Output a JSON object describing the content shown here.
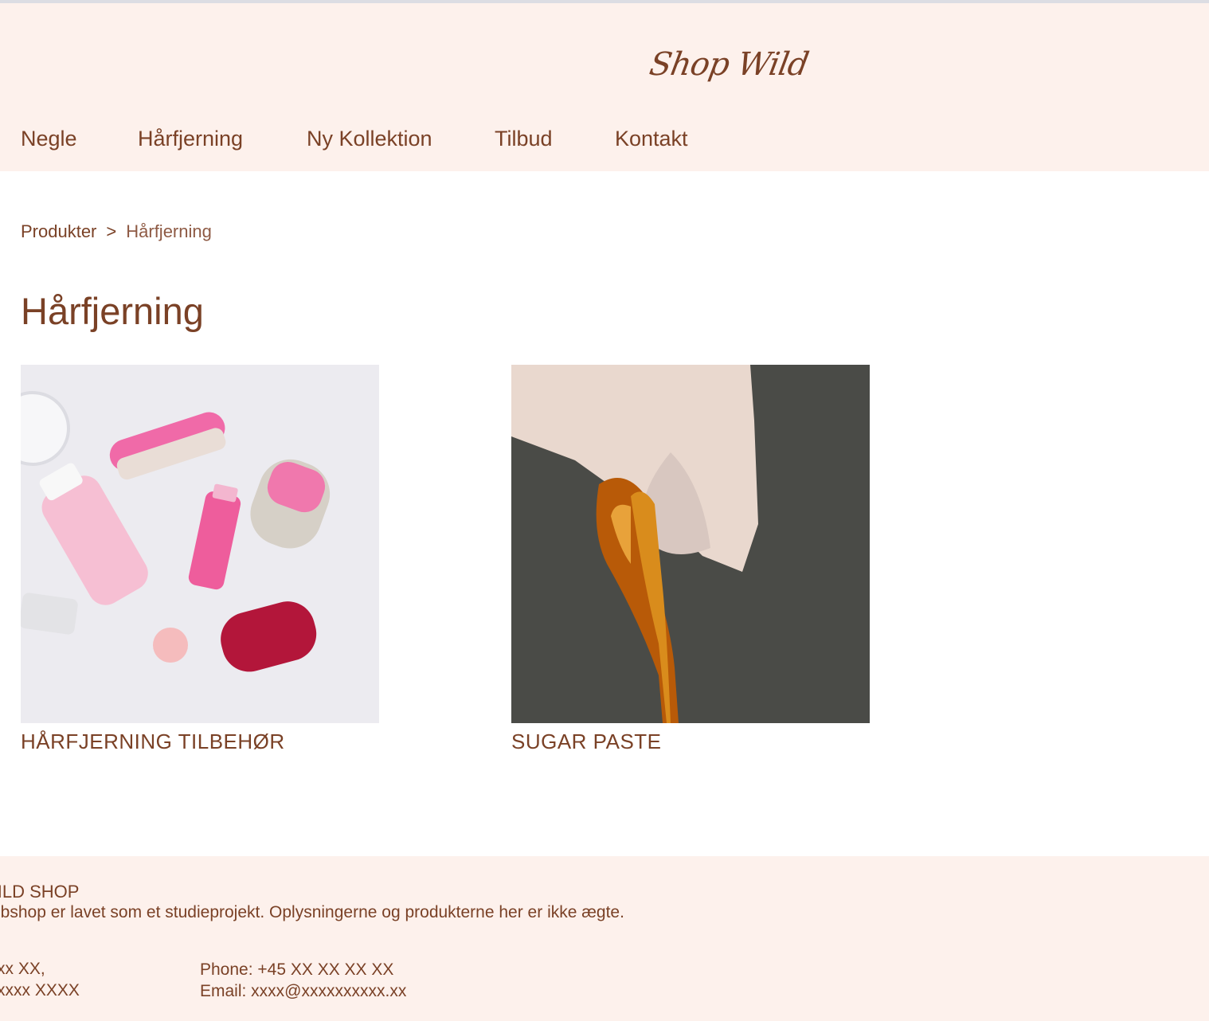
{
  "header": {
    "logo": "Shop Wild",
    "nav": [
      "Negle",
      "Hårfjerning",
      "Ny Kollektion",
      "Tilbud",
      "Kontakt"
    ]
  },
  "breadcrumb": {
    "parent": "Produkter",
    "separator": ">",
    "current": "Hårfjerning"
  },
  "page_title": "Hårfjerning",
  "products": [
    {
      "name": "HÅRFJERNING TILBEHØR",
      "image": "hair-removal-accessories-photo"
    },
    {
      "name": "SUGAR PASTE",
      "image": "sugar-paste-gloved-hand-photo"
    }
  ],
  "footer": {
    "title": "WILD SHOP",
    "description": "ebshop er lavet som et studieprojekt. Oplysningerne og produkterne her er ikke ægte.",
    "address_line1": "xx XX,",
    "address_line2": "xxxx XXXX",
    "phone": "Phone: +45 XX XX XX XX",
    "email": "Email: xxxx@xxxxxxxxxx.xx"
  },
  "colors": {
    "brand_brown": "#7a4126",
    "header_bg": "#fdf1ec"
  }
}
